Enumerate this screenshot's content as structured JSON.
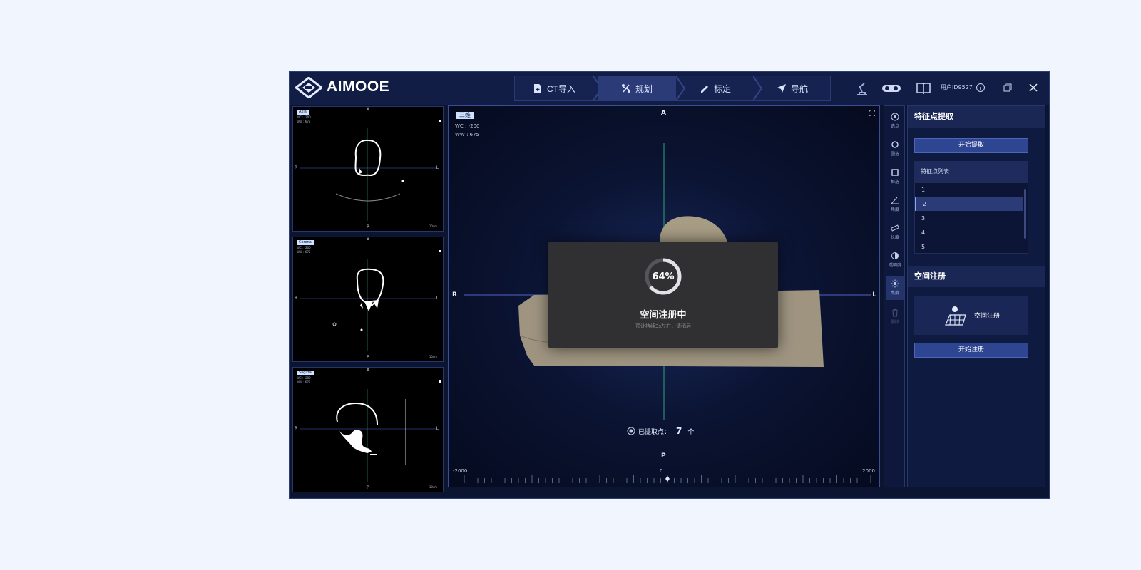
{
  "app": {
    "brand": "AIMOOE",
    "user_id": "用户ID9527"
  },
  "steps": [
    {
      "label": "CT导入",
      "icon": "file-plus-icon"
    },
    {
      "label": "规划",
      "icon": "route-icon",
      "active": true
    },
    {
      "label": "标定",
      "icon": "pen-icon"
    },
    {
      "label": "导航",
      "icon": "navigate-icon"
    }
  ],
  "small_views": [
    {
      "tag": "Axial",
      "wc": "WC : -200",
      "ww": "WW : 675",
      "top": "A",
      "bottom": "P",
      "left": "R",
      "right": "L",
      "scale": "10cm"
    },
    {
      "tag": "Coronal",
      "wc": "WC : -200",
      "ww": "WW : 675",
      "top": "A",
      "bottom": "P",
      "left": "R",
      "right": "L",
      "scale": "10cm"
    },
    {
      "tag": "Sagittal",
      "wc": "WC : -200",
      "ww": "WW : 675",
      "top": "A",
      "bottom": "P",
      "left": "R",
      "right": "L",
      "scale": "10cm"
    }
  ],
  "main_view": {
    "tag": "三维",
    "wc": "WC : -200",
    "ww": "WW : 675",
    "top": "A",
    "bottom": "P",
    "left": "R",
    "right": "L",
    "ruler_min": "-2000",
    "ruler_mid": "0",
    "ruler_max": "2000",
    "loading": {
      "percent": 64,
      "percent_label": "64%",
      "title": "空间注册中",
      "subtitle": "预计持续3s左右，请稍后"
    },
    "counter": {
      "label": "已提取点：",
      "value": "7",
      "unit": "个"
    }
  },
  "tools": [
    {
      "label": "选点",
      "icon": "target-icon"
    },
    {
      "label": "圆选",
      "icon": "circle-icon"
    },
    {
      "label": "框选",
      "icon": "square-icon"
    },
    {
      "label": "角度",
      "icon": "angle-icon"
    },
    {
      "label": "长度",
      "icon": "ruler-icon"
    },
    {
      "label": "透明度",
      "icon": "contrast-icon"
    },
    {
      "label": "亮度",
      "icon": "brightness-icon",
      "active": true
    },
    {
      "label": "删除",
      "icon": "trash-icon",
      "disabled": true
    }
  ],
  "feature_panel": {
    "title": "特征点提取",
    "start_button": "开始提取",
    "list_header": "特征点列表",
    "items": [
      "1",
      "2",
      "3",
      "4",
      "5"
    ],
    "selected_index": 1
  },
  "registration_panel": {
    "title": "空间注册",
    "card_label": "空间注册",
    "start_button": "开始注册"
  }
}
